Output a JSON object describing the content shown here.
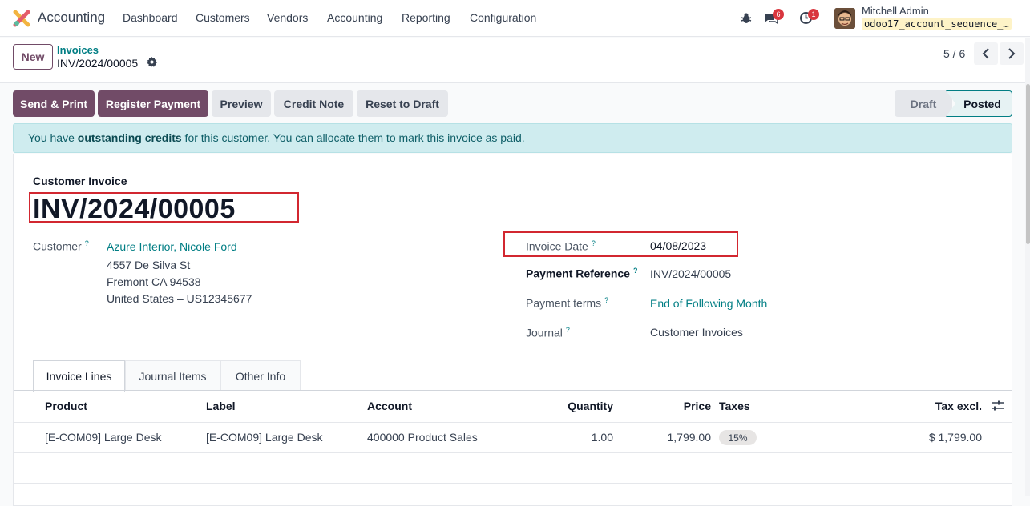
{
  "topbar": {
    "app_name": "Accounting",
    "menu": [
      "Dashboard",
      "Customers",
      "Vendors",
      "Accounting",
      "Reporting",
      "Configuration"
    ],
    "chat_count": "6",
    "activity_count": "1",
    "user_name": "Mitchell Admin",
    "db_name": "odoo17_account_sequence_…"
  },
  "control": {
    "new_label": "New",
    "breadcrumb_parent": "Invoices",
    "breadcrumb_current": "INV/2024/00005",
    "pager": "5 / 6"
  },
  "actions": {
    "send_print": "Send & Print",
    "register_payment": "Register Payment",
    "preview": "Preview",
    "credit_note": "Credit Note",
    "reset_to_draft": "Reset to Draft"
  },
  "statusbar": {
    "draft": "Draft",
    "posted": "Posted"
  },
  "alert": {
    "prefix": "You have ",
    "bold": "outstanding credits",
    "suffix": " for this customer. You can allocate them to mark this invoice as paid."
  },
  "form": {
    "doc_type": "Customer Invoice",
    "doc_name": "INV/2024/00005",
    "customer_label": "Customer",
    "customer_name": "Azure Interior, Nicole Ford",
    "address_line1": "4557 De Silva St",
    "address_line2": "Fremont CA 94538",
    "address_line3": "United States – US12345677",
    "invoice_date_label": "Invoice Date",
    "invoice_date": "04/08/2023",
    "payment_ref_label": "Payment Reference",
    "payment_ref": "INV/2024/00005",
    "payment_terms_label": "Payment terms",
    "payment_terms": "End of Following Month",
    "journal_label": "Journal",
    "journal": "Customer Invoices",
    "help_mark": "?"
  },
  "tabs": [
    "Invoice Lines",
    "Journal Items",
    "Other Info"
  ],
  "table": {
    "headers": [
      "Product",
      "Label",
      "Account",
      "Quantity",
      "Price",
      "Taxes",
      "Tax excl."
    ],
    "rows": [
      {
        "product": "[E-COM09] Large Desk",
        "label": "[E-COM09] Large Desk",
        "account": "400000 Product Sales",
        "quantity": "1.00",
        "price": "1,799.00",
        "taxes": "15%",
        "subtotal": "$ 1,799.00"
      }
    ]
  },
  "colors": {
    "brand": "#714b67",
    "link": "#017e84",
    "highlight_box": "#d22730"
  }
}
